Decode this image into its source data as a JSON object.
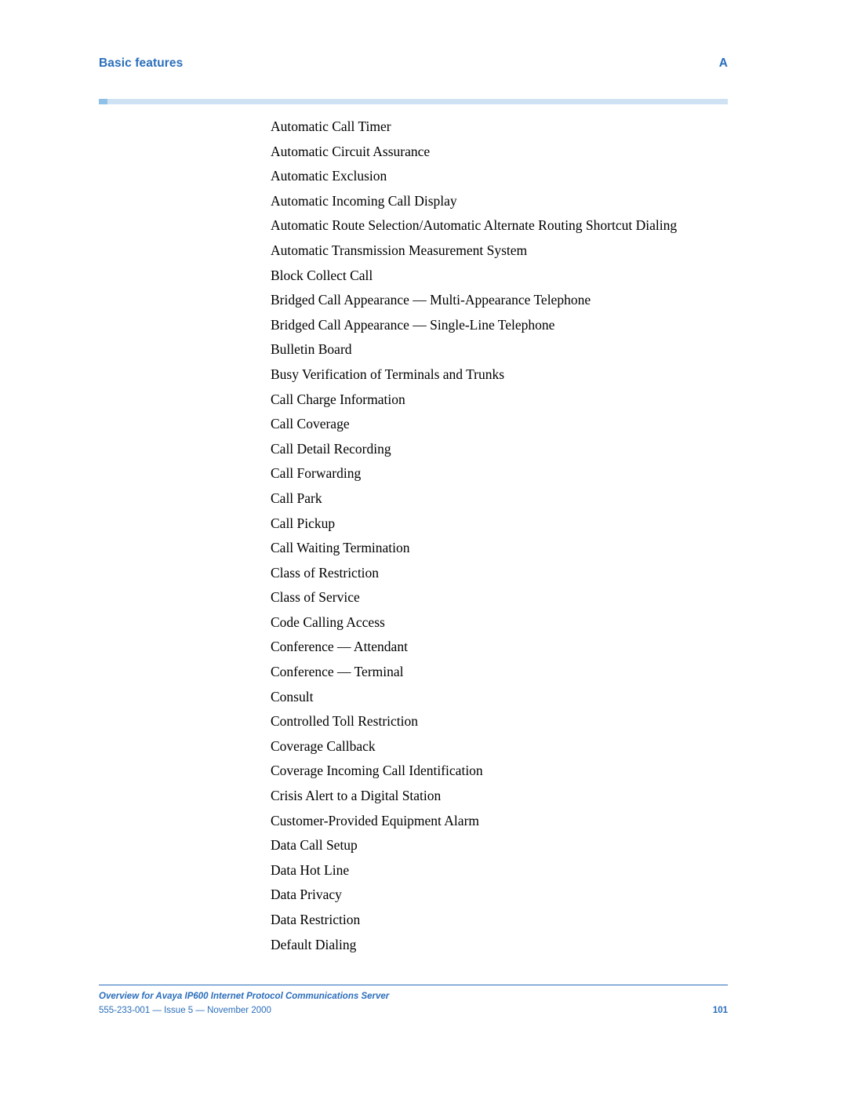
{
  "header": {
    "title": "Basic features",
    "letter": "A"
  },
  "features": [
    "Automatic Call Timer",
    "Automatic Circuit Assurance",
    "Automatic Exclusion",
    "Automatic Incoming Call Display",
    "Automatic Route Selection/Automatic Alternate Routing Shortcut Dialing",
    "Automatic Transmission Measurement System",
    "Block Collect Call",
    "Bridged Call Appearance — Multi-Appearance Telephone",
    "Bridged Call Appearance — Single-Line Telephone",
    "Bulletin Board",
    "Busy Verification of Terminals and Trunks",
    "Call Charge Information",
    "Call Coverage",
    "Call Detail Recording",
    "Call Forwarding",
    "Call Park",
    "Call Pickup",
    "Call Waiting Termination",
    "Class of Restriction",
    "Class of Service",
    "Code Calling Access",
    "Conference — Attendant",
    "Conference — Terminal",
    "Consult",
    "Controlled Toll Restriction",
    "Coverage Callback",
    "Coverage Incoming Call Identification",
    "Crisis Alert to a Digital Station",
    "Customer-Provided Equipment Alarm",
    "Data Call Setup",
    "Data Hot Line",
    "Data Privacy",
    "Data Restriction",
    "Default Dialing"
  ],
  "footer": {
    "document_title": "Overview for Avaya IP600 Internet Protocol Communications Server",
    "document_info": "555-233-001 — Issue 5 — November 2000",
    "page_number": "101"
  },
  "colors": {
    "accent": "#2a6ebb",
    "rule_light": "#cfe2f3",
    "rule_dark": "#8fc0e8"
  }
}
